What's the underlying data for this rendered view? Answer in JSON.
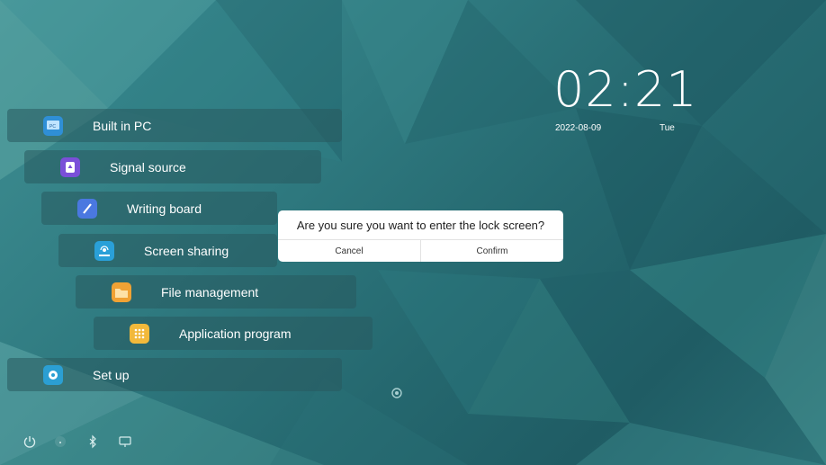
{
  "menu": {
    "items": [
      {
        "id": "built-in-pc",
        "label": "Built in PC",
        "icon": "pc-icon",
        "color": "#2f8fd6"
      },
      {
        "id": "signal-source",
        "label": "Signal source",
        "icon": "signal-source-icon",
        "color": "#7a4fd8"
      },
      {
        "id": "writing-board",
        "label": "Writing board",
        "icon": "pen-icon",
        "color": "#4a78e0"
      },
      {
        "id": "screen-sharing",
        "label": "Screen sharing",
        "icon": "screen-share-icon",
        "color": "#2aa0d8"
      },
      {
        "id": "file-management",
        "label": "File management",
        "icon": "folder-icon",
        "color": "#f0a234"
      },
      {
        "id": "application-program",
        "label": "Application program",
        "icon": "apps-grid-icon",
        "color": "#f2b93b"
      },
      {
        "id": "set-up",
        "label": "Set up",
        "icon": "settings-icon",
        "color": "#2b9fd3"
      }
    ]
  },
  "clock": {
    "time": "02:21",
    "date": "2022-08-09",
    "weekday": "Tue"
  },
  "dialog": {
    "title": "Are you sure you want to enter the lock screen?",
    "cancel_label": "Cancel",
    "confirm_label": "Confirm"
  },
  "bottom_bar": {
    "icons": [
      "power-icon",
      "dot-icon",
      "bluetooth-icon",
      "display-icon"
    ]
  }
}
